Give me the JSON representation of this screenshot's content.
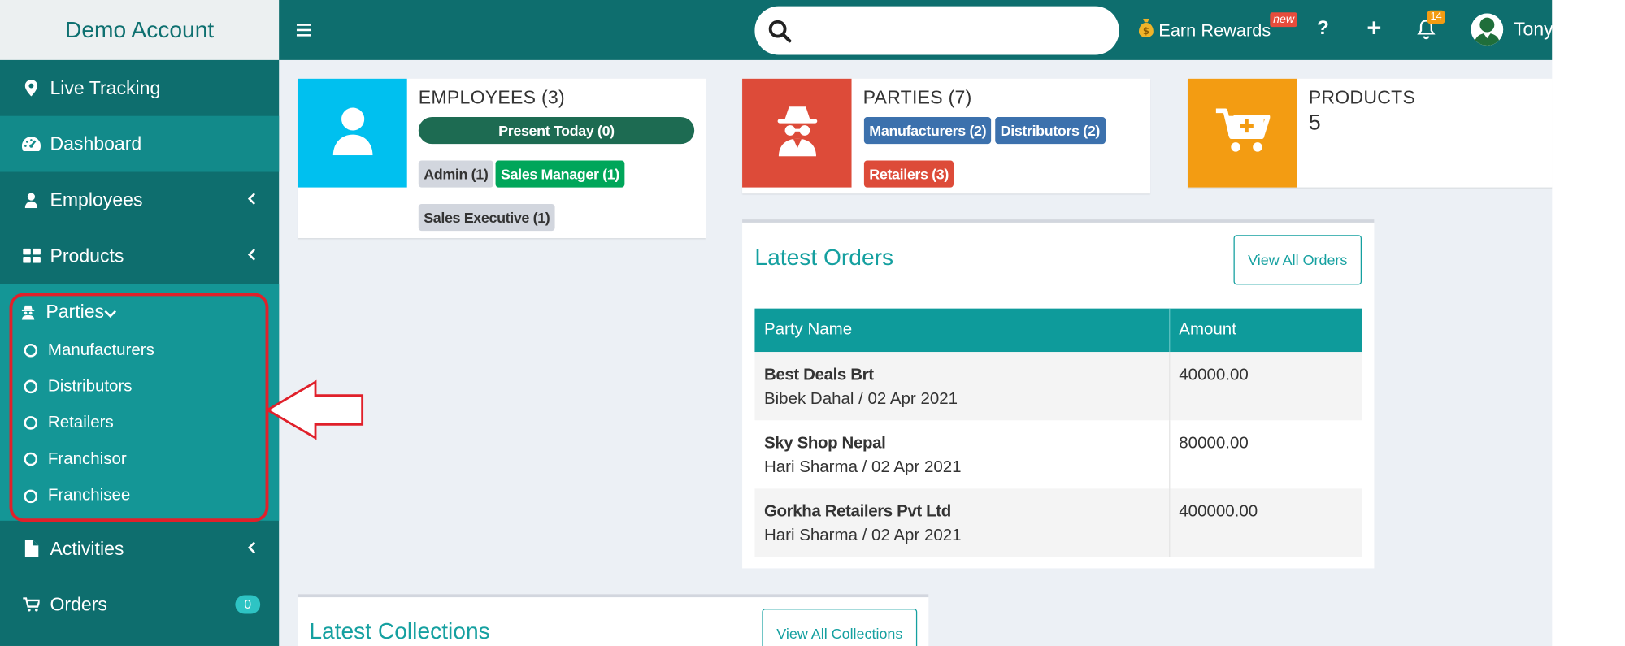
{
  "sidebar": {
    "brand": "Demo Account",
    "items": [
      {
        "label": "Live Tracking"
      },
      {
        "label": "Dashboard"
      },
      {
        "label": "Employees"
      },
      {
        "label": "Products"
      }
    ],
    "parties": {
      "label": "Parties",
      "sub_items": [
        "Manufacturers",
        "Distributors",
        "Retailers",
        "Franchisor",
        "Franchisee"
      ]
    },
    "activities": {
      "label": "Activities"
    },
    "orders": {
      "label": "Orders",
      "badge": "0"
    }
  },
  "header": {
    "search_placeholder": "",
    "earn_rewards": "Earn Rewards",
    "new_tag": "new",
    "help": "?",
    "add": "+",
    "notifications_count": "14",
    "user_name": "Tony"
  },
  "employees": {
    "title": "EMPLOYEES (3)",
    "present_today": "Present Today (0)",
    "admin": "Admin (1)",
    "sales_manager": "Sales Manager (1)",
    "sales_executive": "Sales Executive (1)"
  },
  "parties_box": {
    "title": "PARTIES (7)",
    "manufacturers": "Manufacturers (2)",
    "distributors": "Distributors (2)",
    "retailers": "Retailers (3)"
  },
  "products_box": {
    "title": "PRODUCTS",
    "count": "5"
  },
  "latest_orders": {
    "title": "Latest Orders",
    "view_all": "View All Orders",
    "columns": [
      "Party Name",
      "Amount"
    ],
    "rows": [
      {
        "party": "Best Deals Brt",
        "meta": "Bibek Dahal / 02 Apr 2021",
        "amount": "40000.00"
      },
      {
        "party": "Sky Shop Nepal",
        "meta": "Hari Sharma / 02 Apr 2021",
        "amount": "80000.00"
      },
      {
        "party": "Gorkha Retailers Pvt Ltd",
        "meta": "Hari Sharma / 02 Apr 2021",
        "amount": "400000.00"
      }
    ]
  },
  "latest_collections": {
    "title": "Latest Collections",
    "view_all": "View All Collections"
  },
  "colors": {
    "sidebar": "#0e6e6e",
    "accent": "#15a0a0",
    "employees_icon_bg": "#00c0ef",
    "parties_icon_bg": "#dd4b39",
    "products_icon_bg": "#f39c12",
    "annotation": "#e0202a"
  },
  "icons": [
    "map-marker-icon",
    "dashboard-icon",
    "user-icon",
    "grid-icon",
    "spy-icon",
    "file-icon",
    "cart-icon",
    "search-icon",
    "money-bag-icon",
    "bell-icon",
    "add-to-cart-icon"
  ]
}
